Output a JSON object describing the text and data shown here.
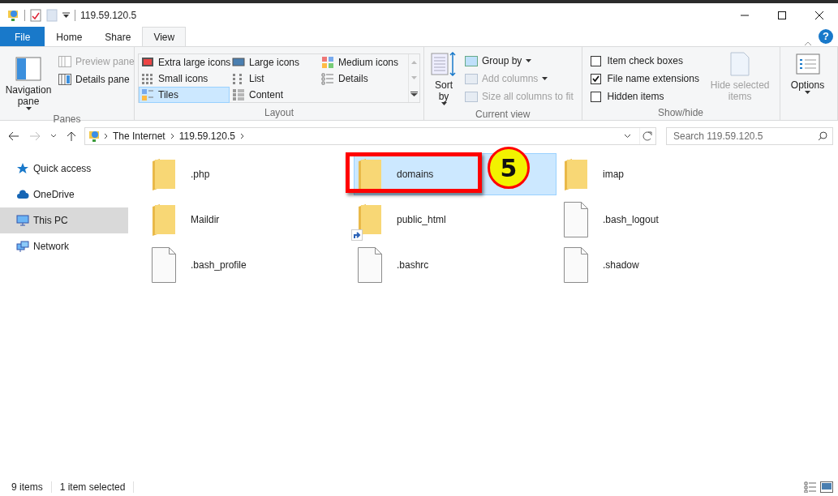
{
  "window": {
    "title": "119.59.120.5"
  },
  "ribbon_tabs": [
    {
      "label": "File",
      "kind": "file",
      "selected": false
    },
    {
      "label": "Home",
      "kind": "tab",
      "selected": false
    },
    {
      "label": "Share",
      "kind": "tab",
      "selected": false
    },
    {
      "label": "View",
      "kind": "tab",
      "selected": true
    }
  ],
  "help": "?",
  "ribbon": {
    "panes": {
      "group": "Panes",
      "navigation_pane": {
        "label": "Navigation pane",
        "dropdown": true
      },
      "items": [
        {
          "label": "Preview pane",
          "disabled": true
        },
        {
          "label": "Details pane",
          "disabled": false
        }
      ]
    },
    "layout": {
      "group": "Layout",
      "options": [
        {
          "label": "Extra large icons",
          "selected": false
        },
        {
          "label": "Large icons",
          "selected": false
        },
        {
          "label": "Medium icons",
          "selected": false
        },
        {
          "label": "Small icons",
          "selected": false
        },
        {
          "label": "List",
          "selected": false
        },
        {
          "label": "Details",
          "selected": false
        },
        {
          "label": "Tiles",
          "selected": true
        },
        {
          "label": "Content",
          "selected": false
        }
      ]
    },
    "current_view": {
      "group": "Current view",
      "sort_by": {
        "label": "Sort by",
        "dropdown": true
      },
      "items": [
        {
          "label": "Group by",
          "disabled": false,
          "dropdown": true
        },
        {
          "label": "Add columns",
          "disabled": true,
          "dropdown": true
        },
        {
          "label": "Size all columns to fit",
          "disabled": true,
          "dropdown": false
        }
      ]
    },
    "show_hide": {
      "group": "Show/hide",
      "checkboxes": [
        {
          "label": "Item check boxes",
          "checked": false
        },
        {
          "label": "File name extensions",
          "checked": true
        },
        {
          "label": "Hidden items",
          "checked": false
        }
      ],
      "hide_selected": {
        "label": "Hide selected items",
        "disabled": true
      }
    },
    "options": {
      "label": "Options",
      "dropdown": true
    }
  },
  "address": {
    "path": [
      "The Internet",
      "119.59.120.5"
    ],
    "search_placeholder": "Search 119.59.120.5"
  },
  "sidebar": {
    "items": [
      {
        "label": "Quick access",
        "kind": "star",
        "selected": false
      },
      {
        "label": "OneDrive",
        "kind": "cloud",
        "selected": false
      },
      {
        "label": "This PC",
        "kind": "pc",
        "selected": true
      },
      {
        "label": "Network",
        "kind": "network",
        "selected": false
      }
    ]
  },
  "files": [
    {
      "name": ".php",
      "kind": "folder",
      "selected": false,
      "shortcut": false,
      "annotated": false
    },
    {
      "name": "domains",
      "kind": "folder",
      "selected": true,
      "shortcut": false,
      "annotated": true
    },
    {
      "name": "imap",
      "kind": "folder",
      "selected": false,
      "shortcut": false,
      "annotated": false
    },
    {
      "name": "Maildir",
      "kind": "folder",
      "selected": false,
      "shortcut": false,
      "annotated": false
    },
    {
      "name": "public_html",
      "kind": "folder",
      "selected": false,
      "shortcut": true,
      "annotated": false
    },
    {
      "name": ".bash_logout",
      "kind": "file",
      "selected": false,
      "shortcut": false,
      "annotated": false
    },
    {
      "name": ".bash_profile",
      "kind": "file",
      "selected": false,
      "shortcut": false,
      "annotated": false
    },
    {
      "name": ".bashrc",
      "kind": "file",
      "selected": false,
      "shortcut": false,
      "annotated": false
    },
    {
      "name": ".shadow",
      "kind": "file",
      "selected": false,
      "shortcut": false,
      "annotated": false
    }
  ],
  "annotation": {
    "step": "5"
  },
  "status_bar": {
    "count": "9 items",
    "selection": "1 item selected"
  }
}
